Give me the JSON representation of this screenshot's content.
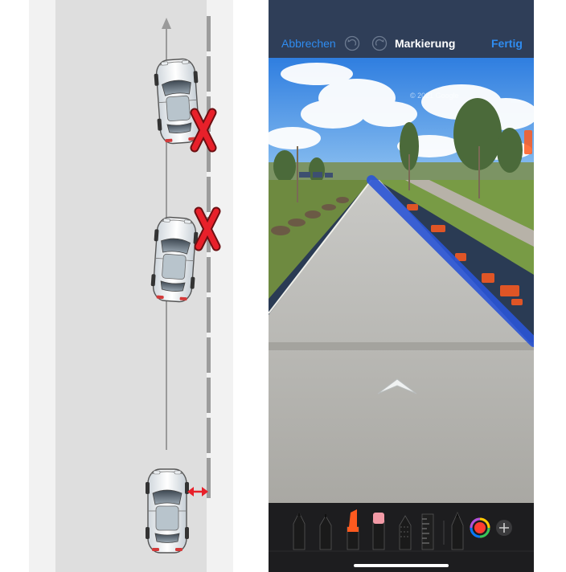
{
  "diagram": {
    "cars": [
      {
        "name": "car-top",
        "status": "wrong"
      },
      {
        "name": "car-middle",
        "status": "wrong"
      },
      {
        "name": "car-bottom",
        "status": "ok"
      }
    ],
    "markers": {
      "wrong": "x-mark-icon",
      "ok": "double-arrow-icon"
    },
    "colors": {
      "road": "#dedede",
      "shoulder": "#f2f2f2",
      "wrong": "#e8202a",
      "arrow": "#9a9a9a"
    }
  },
  "phone": {
    "topbar": {
      "cancel_label": "Abbrechen",
      "title": "Markierung",
      "done_label": "Fertig",
      "undo_icon": "undo-icon",
      "redo_icon": "redo-icon"
    },
    "street_view": {
      "watermark": "© 2021 Google",
      "annotation_color": "#2b55d6",
      "nav_icon": "chevron-up-icon"
    },
    "tools": [
      {
        "icon": "pen-icon",
        "tip_color": "#111111"
      },
      {
        "icon": "fineliner-icon",
        "tip_color": "#111111"
      },
      {
        "icon": "marker-icon",
        "tip_color": "#ff5a1f"
      },
      {
        "icon": "eraser-icon",
        "tip_color": "#f29aa6"
      },
      {
        "icon": "lasso-icon",
        "tip_color": "#555555"
      },
      {
        "icon": "ruler-icon",
        "tip_color": "#333333"
      },
      {
        "icon": "pencil-icon",
        "tip_color": "#111111"
      },
      {
        "icon": "color-picker-icon",
        "tip_color": "#ff3b30"
      },
      {
        "icon": "plus-icon",
        "tip_color": "#aaaaaa"
      }
    ],
    "accent_color": "#2f8cf0"
  }
}
